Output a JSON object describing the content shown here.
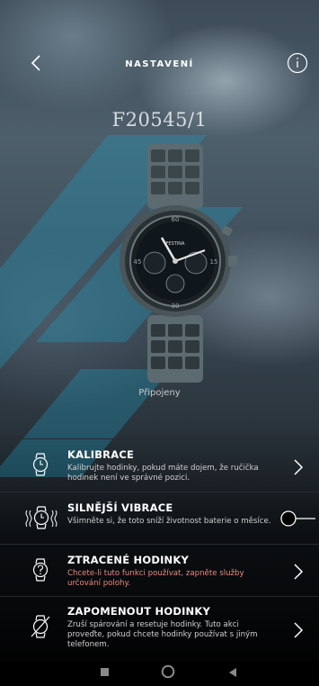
{
  "header": {
    "title": "NASTAVENÍ",
    "back_icon": "chevron-left-icon",
    "info_icon": "info-circle-icon"
  },
  "device": {
    "model": "F20545/1",
    "status": "Připojeny",
    "dial_brand": "FESTINA"
  },
  "menu": {
    "items": [
      {
        "title": "KALIBRACE",
        "description": "Kalibrujte hodinky, pokud máte dojem, že ručička hodinek není ve správné pozici.",
        "icon": "watch-icon",
        "control": "chevron-right-icon"
      },
      {
        "title": "SILNĚJŠÍ VIBRACE",
        "description": "Všimněte si, že toto sníží životnost baterie o měsíce.",
        "icon": "watch-vibrate-icon",
        "control": "toggle",
        "enabled": false
      },
      {
        "title": "ZTRACENÉ HODINKY",
        "description": "Chcete-li tuto funkci používat, zapněte služby určování polohy.",
        "icon": "watch-question-icon",
        "control": "chevron-right-icon",
        "description_color": "#e88a7f"
      },
      {
        "title": "ZAPOMENOUT HODINKY",
        "description": "Zruší spárování a resetuje hodinky. Tuto akci proveďte, pokud chcete hodinky používat s jiným telefonem.",
        "icon": "watch-crossed-icon",
        "control": "chevron-right-icon"
      }
    ]
  },
  "system_nav": {
    "recents_icon": "square-icon",
    "home_icon": "circle-icon",
    "back_icon": "triangle-back-icon"
  },
  "colors": {
    "accent_watermark": "#1f9fc4",
    "warning_text": "#e88a7f"
  }
}
